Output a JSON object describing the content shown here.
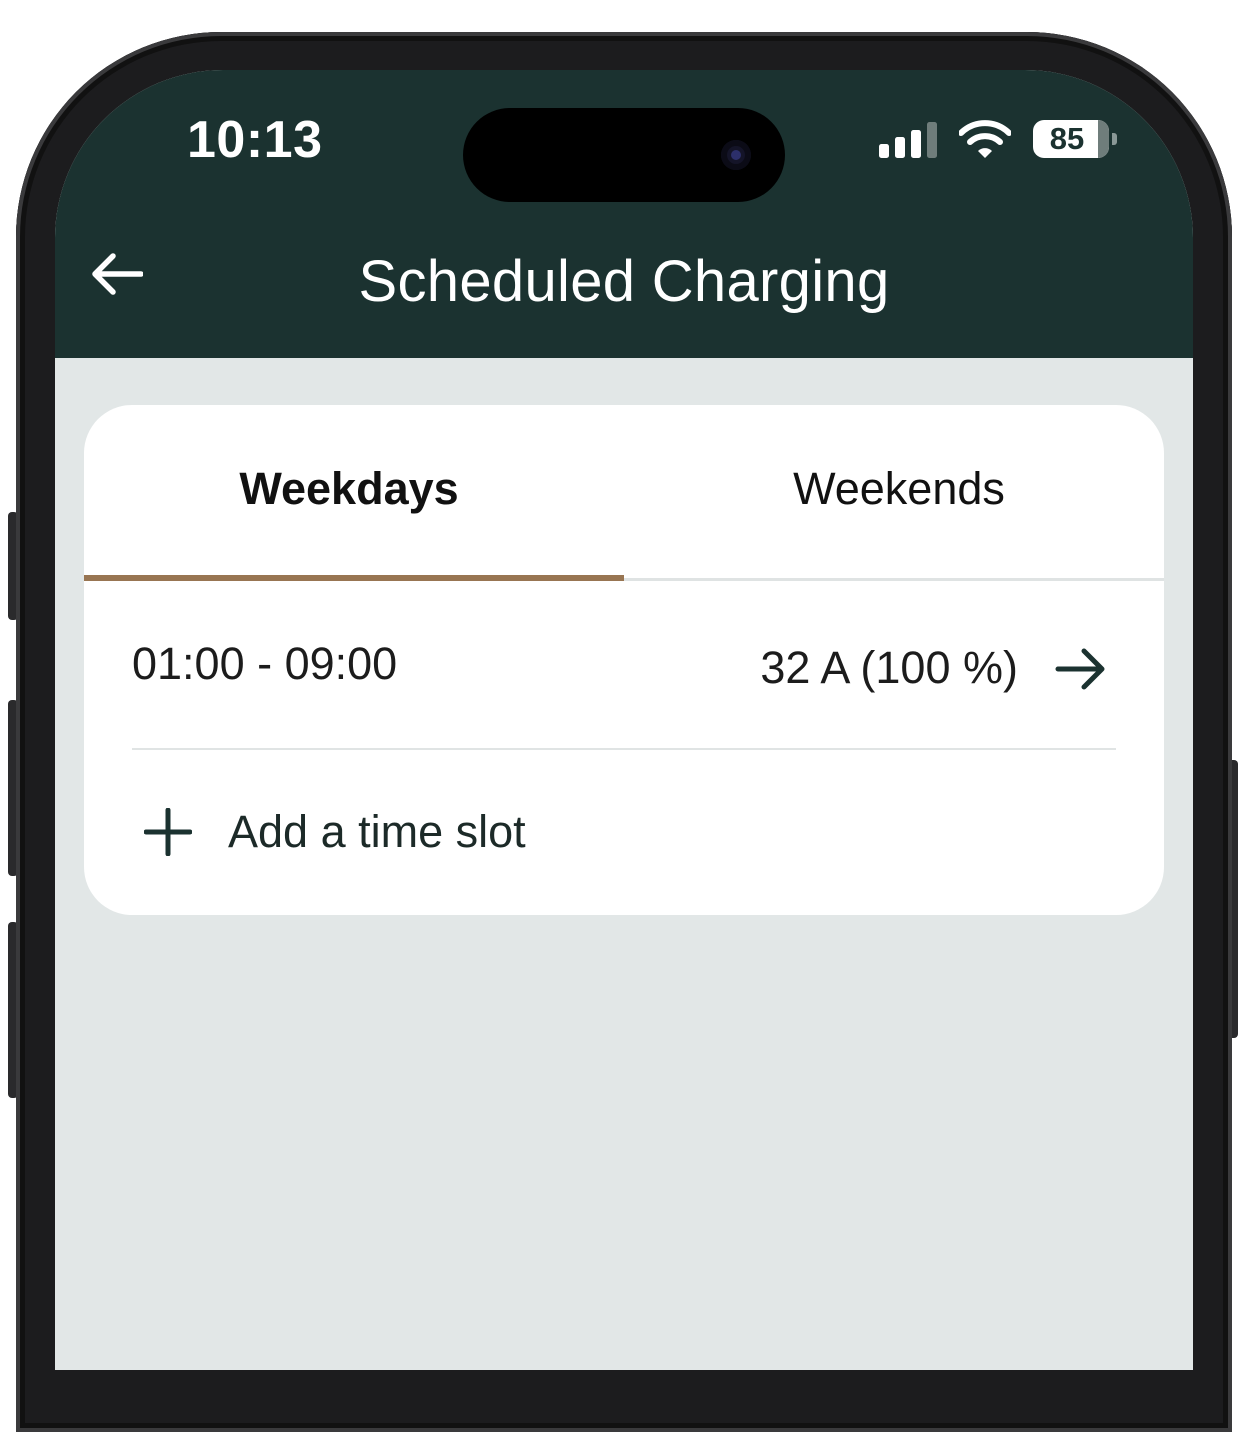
{
  "status_bar": {
    "time": "10:13",
    "battery_level": "85",
    "battery_fraction": 0.85
  },
  "nav": {
    "title": "Scheduled Charging",
    "back_icon": "arrow-left-icon"
  },
  "tabs": [
    {
      "label": "Weekdays",
      "selected": true
    },
    {
      "label": "Weekends",
      "selected": false
    }
  ],
  "schedule": {
    "slots": [
      {
        "time_range": "01:00 - 09:00",
        "current": "32 A (100 %)",
        "icon": "arrow-right-icon"
      }
    ],
    "add_label": "Add a time slot",
    "add_icon": "plus-icon"
  },
  "colors": {
    "header_bg": "#1b3230",
    "screen_bg": "#e2e7e7",
    "tab_indicator": "#987552",
    "icon": "#1b3230"
  }
}
